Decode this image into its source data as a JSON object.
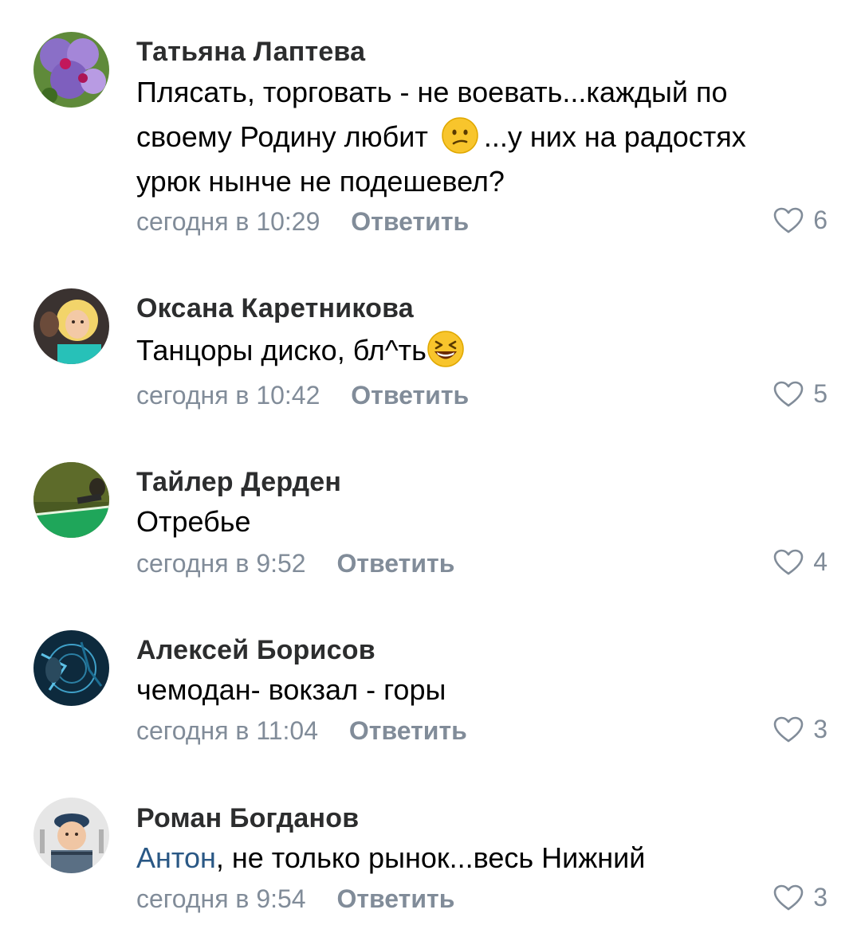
{
  "comments": [
    {
      "author": "Татьяна Лаптева",
      "text_line1": "Плясать, торговать - не воевать...каждый по",
      "text_line2_before": "своему Родину любит",
      "text_line2_after": "...у них на радостях",
      "text_line3": "урюк нынче не подешевел?",
      "emoji": "confused-face-icon",
      "time": "сегодня в 10:29",
      "reply": "Ответить",
      "likes": "6"
    },
    {
      "author": "Оксана Каретникова",
      "text": "Танцоры диско, бл^ть",
      "emoji": "laughing-face-icon",
      "time": "сегодня в 10:42",
      "reply": "Ответить",
      "likes": "5"
    },
    {
      "author": "Тайлер Дерден",
      "text": "Отребье",
      "time": "сегодня в 9:52",
      "reply": "Ответить",
      "likes": "4"
    },
    {
      "author": "Алексей Борисов",
      "text": "чемодан- вокзал - горы",
      "time": "сегодня в 11:04",
      "reply": "Ответить",
      "likes": "3"
    },
    {
      "author": "Роман Богданов",
      "mention": "Антон",
      "text": ", не только рынок...весь Нижний",
      "time": "сегодня в 9:54",
      "reply": "Ответить",
      "likes": "3"
    }
  ],
  "colors": {
    "author": "#2c2d2e",
    "meta": "#818c99",
    "mention": "#2a5885"
  }
}
